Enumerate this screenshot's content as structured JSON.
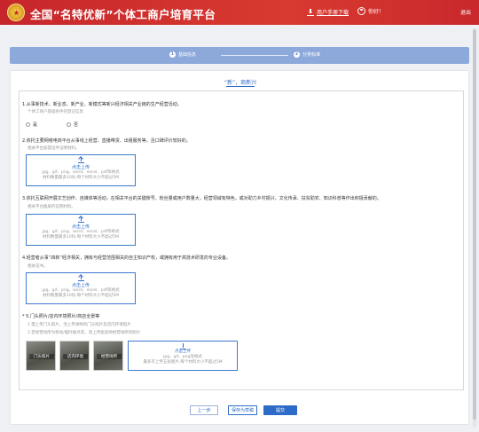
{
  "header": {
    "title": "全国“名特优新”个体工商户培育平台",
    "manual_download": "用户手册下载",
    "greeting": "你好！",
    "exit": "退出"
  },
  "steps": [
    {
      "num": "1",
      "label": "基础信息"
    },
    {
      "num": "2",
      "label": "分类标准"
    }
  ],
  "section_title": "“新”，商新兴",
  "q1": {
    "text": "1.从事新技术、新业态、新产业、新模式等新兴经济相关产业链的生产经营活动。",
    "hint": "个体工商户基础条件的登记信息",
    "options": [
      "是",
      "否"
    ]
  },
  "q2": {
    "text": "2.依托主要网络电商平台从事线上经营、直播带货、出租服务等，且口碑评价较好的。",
    "hint": "相关平台加盟证件证明材料。"
  },
  "q3": {
    "text": "3.依托互联网开展文艺创作、自媒体等活动，在相关平台的关键账号、粉丝量或用户数量大，经营领域有特色，或对助力乡村振兴、文化传承、扶贫助农、知识科普等作出积极贡献的。",
    "hint": "相关平台截屏的证明材料。"
  },
  "q4": {
    "text": "4.经营者从事“四新”经济相关，拥有与经营范围相关的自主知识产权，或拥有用于高技术研发的专业设备。",
    "hint": "相关证书。"
  },
  "q5": {
    "text": "* 5.门头照片/店内环境照片/商店全景等",
    "hint1": "1.需上传门头照片，须上传清晰的门头照片及店内环境照片",
    "hint2": "2.若经营场所为移动/临时摊点等，须上传能反映经营场所的照片",
    "photos": [
      "门头照片",
      "店内环境",
      "经营场所"
    ]
  },
  "upload": {
    "label": "点击上传",
    "formats": "jpg、gif、png、word、excel、pdf等格式",
    "limit": "材料数量最多10份,每个材料大小不超过5M"
  },
  "upload_image": {
    "formats": "jpg、gif、png等格式",
    "limit": "最多可上传五张图片,每个材料大小不超过5M"
  },
  "buttons": {
    "prev": "上一步",
    "save": "保存为草稿",
    "submit": "提交"
  }
}
